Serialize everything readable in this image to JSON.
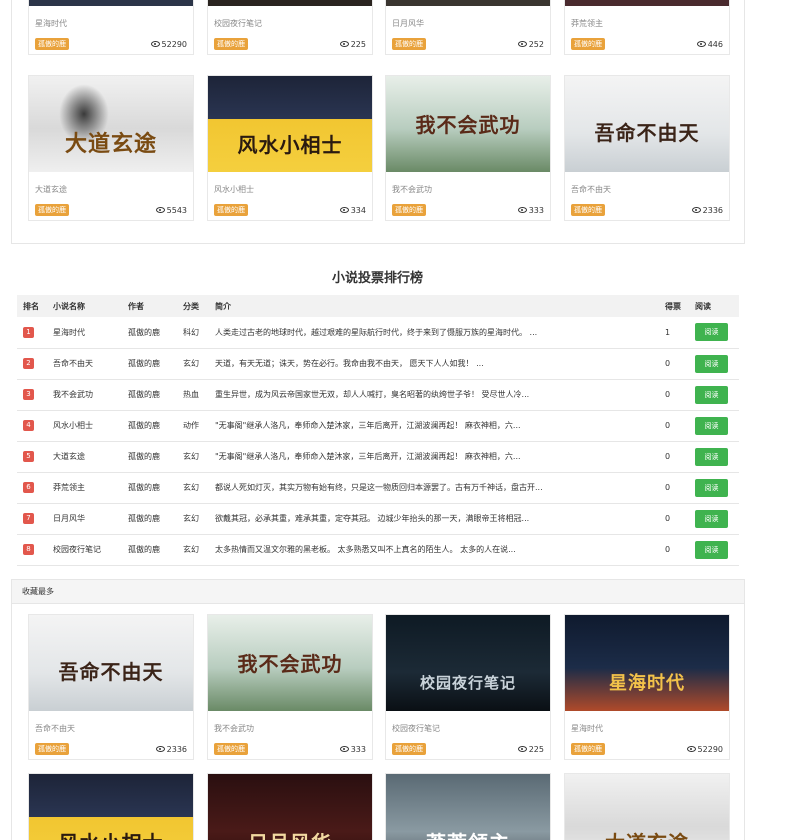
{
  "author_tag": "孤傲的鹿",
  "top_panel": {
    "row1": [
      {
        "name": "星海时代",
        "views": "52290"
      },
      {
        "name": "校园夜行笔记",
        "views": "225"
      },
      {
        "name": "日月风华",
        "views": "252"
      },
      {
        "name": "莽荒领主",
        "views": "446"
      }
    ],
    "row2": [
      {
        "name": "大道玄途",
        "views": "5543",
        "cover_text": "大道玄途"
      },
      {
        "name": "风水小相士",
        "views": "334",
        "cover_text": "风水小相士"
      },
      {
        "name": "我不会武功",
        "views": "333",
        "cover_text": "我不会武功"
      },
      {
        "name": "吾命不由天",
        "views": "2336",
        "cover_text": "吾命不由天"
      }
    ]
  },
  "ranking": {
    "title": "小说投票排行榜",
    "headers": [
      "排名",
      "小说名称",
      "作者",
      "分类",
      "简介",
      "得票",
      "阅读"
    ],
    "read_label": "阅读",
    "rows": [
      {
        "rank": "1",
        "name": "星海时代",
        "author": "孤傲的鹿",
        "category": "科幻",
        "intro": "人类走过古老的地球时代，越过艰难的星际航行时代，终于来到了慑服万族的星海时代。 ...",
        "votes": "1"
      },
      {
        "rank": "2",
        "name": "吾命不由天",
        "author": "孤傲的鹿",
        "category": "玄幻",
        "intro": "天道，有天无道；诛天，势在必行。我命由我不由天， 愿天下人人如我！    ...",
        "votes": "0"
      },
      {
        "rank": "3",
        "name": "我不会武功",
        "author": "孤傲的鹿",
        "category": "热血",
        "intro": "重生异世，成为风云帝国家世无双，却人人喊打，臭名昭著的纨绔世子爷！ 受尽世人冷...",
        "votes": "0"
      },
      {
        "rank": "4",
        "name": "风水小相士",
        "author": "孤傲的鹿",
        "category": "动作",
        "intro": "\"无事阁\"继承人洛凡，奉师命入楚沐家，三年后离开，江湖波澜再起！ 麻衣神相，六...",
        "votes": "0"
      },
      {
        "rank": "5",
        "name": "大道玄途",
        "author": "孤傲的鹿",
        "category": "玄幻",
        "intro": "\"无事阁\"继承人洛凡，奉师命入楚沐家，三年后离开，江湖波澜再起！ 麻衣神相，六...",
        "votes": "0"
      },
      {
        "rank": "6",
        "name": "莽荒领主",
        "author": "孤傲的鹿",
        "category": "玄幻",
        "intro": "都说人死如灯灭，其实万物有始有终，只是这一物质回归本源罢了。古有万千神话，盘古开...",
        "votes": "0"
      },
      {
        "rank": "7",
        "name": "日月风华",
        "author": "孤傲的鹿",
        "category": "玄幻",
        "intro": "欲戴其冠，必承其重，难承其重，定夺其冠。 边城少年抬头的那一天，满眼帝王将相冠...",
        "votes": "0"
      },
      {
        "rank": "8",
        "name": "校园夜行笔记",
        "author": "孤傲的鹿",
        "category": "玄幻",
        "intro": "太多热情而又温文尔雅的黑老板。 太多熟悉又叫不上真名的陌生人。 太多的人在说...",
        "votes": "0"
      }
    ]
  },
  "collect": {
    "header": "收藏最多",
    "row1": [
      {
        "name": "吾命不由天",
        "views": "2336",
        "cover_text": "吾命不由天"
      },
      {
        "name": "我不会武功",
        "views": "333",
        "cover_text": "我不会武功"
      },
      {
        "name": "校园夜行笔记",
        "views": "225",
        "cover_text": "校园夜行笔记"
      },
      {
        "name": "星海时代",
        "views": "52290",
        "cover_text": "星海时代"
      }
    ],
    "row2_covers": [
      "风水小相士",
      "日月风华",
      "莽荒领主",
      "大道玄途"
    ]
  },
  "colors": {
    "tag": "#e9a23b",
    "read_button": "#3fb34f",
    "rank_badge": "#e2574c"
  }
}
